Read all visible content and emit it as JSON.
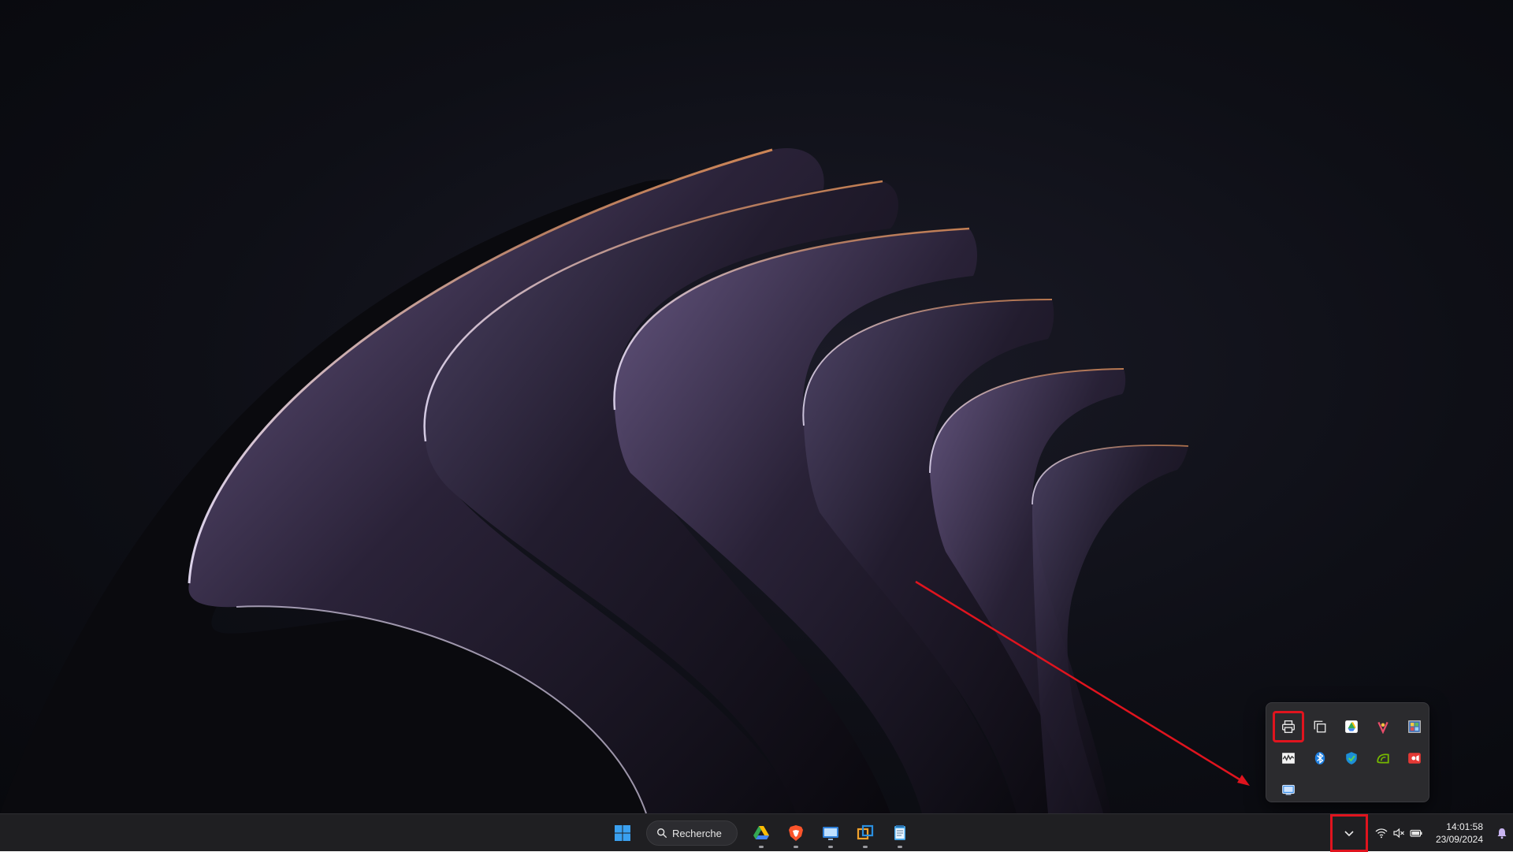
{
  "taskbar": {
    "search_label": "Recherche",
    "pinned_apps": [
      {
        "name": "google-drive-icon"
      },
      {
        "name": "brave-browser-icon"
      },
      {
        "name": "remote-desktop-icon"
      },
      {
        "name": "virtualbox-icon"
      },
      {
        "name": "notepad-icon"
      }
    ],
    "clock": {
      "time": "14:01:58",
      "date": "23/09/2024"
    }
  },
  "tray_flyout": {
    "icons": [
      {
        "name": "printer-icon",
        "highlighted": true
      },
      {
        "name": "copy-icon"
      },
      {
        "name": "google-drive-icon"
      },
      {
        "name": "sparkle-app-icon"
      },
      {
        "name": "control-panel-icon"
      },
      {
        "name": "monitor-graph-icon"
      },
      {
        "name": "bluetooth-icon"
      },
      {
        "name": "windows-security-icon"
      },
      {
        "name": "nvidia-icon"
      },
      {
        "name": "screen-recorder-icon"
      },
      {
        "name": "display-icon"
      }
    ]
  },
  "colors": {
    "annotation_red": "#e0141e",
    "taskbar_bg": "#1f1f22",
    "flyout_bg": "#2b2b2e"
  }
}
